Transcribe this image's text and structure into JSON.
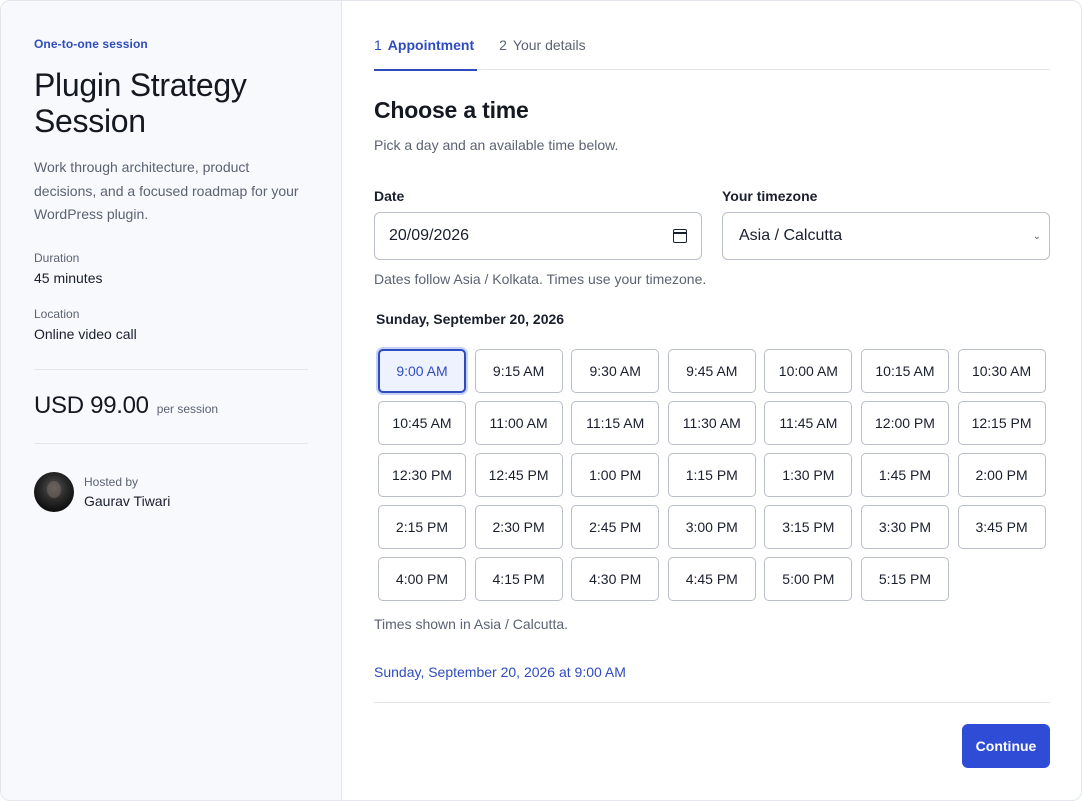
{
  "sidebar": {
    "eyebrow": "One-to-one session",
    "title": "Plugin Strategy Session",
    "description": "Work through architecture, product decisions, and a focused roadmap for your WordPress plugin.",
    "duration_label": "Duration",
    "duration_value": "45 minutes",
    "location_label": "Location",
    "location_value": "Online video call",
    "price": "USD 99.00",
    "price_unit": "per session",
    "host_label": "Hosted by",
    "host_name": "Gaurav Tiwari"
  },
  "steps": [
    {
      "num": "1",
      "label": "Appointment",
      "active": true
    },
    {
      "num": "2",
      "label": "Your details",
      "active": false
    }
  ],
  "main": {
    "heading": "Choose a time",
    "subheading": "Pick a day and an available time below.",
    "date_label": "Date",
    "date_value": "20/09/2026",
    "timezone_label": "Your timezone",
    "timezone_value": "Asia / Calcutta",
    "hint": "Dates follow Asia / Kolkata. Times use your timezone.",
    "day_heading": "Sunday, September 20, 2026",
    "slots": [
      "9:00 AM",
      "9:15 AM",
      "9:30 AM",
      "9:45 AM",
      "10:00 AM",
      "10:15 AM",
      "10:30 AM",
      "10:45 AM",
      "11:00 AM",
      "11:15 AM",
      "11:30 AM",
      "11:45 AM",
      "12:00 PM",
      "12:15 PM",
      "12:30 PM",
      "12:45 PM",
      "1:00 PM",
      "1:15 PM",
      "1:30 PM",
      "1:45 PM",
      "2:00 PM",
      "2:15 PM",
      "2:30 PM",
      "2:45 PM",
      "3:00 PM",
      "3:15 PM",
      "3:30 PM",
      "3:45 PM",
      "4:00 PM",
      "4:15 PM",
      "4:30 PM",
      "4:45 PM",
      "5:00 PM",
      "5:15 PM"
    ],
    "selected_slot": "9:00 AM",
    "tz_note": "Times shown in Asia / Calcutta.",
    "selection_summary": "Sunday, September 20, 2026 at 9:00 AM",
    "continue_label": "Continue"
  },
  "colors": {
    "accent": "#2f4cbf",
    "button": "#2f4cd6",
    "sidebar_bg": "#f7f9fc"
  }
}
